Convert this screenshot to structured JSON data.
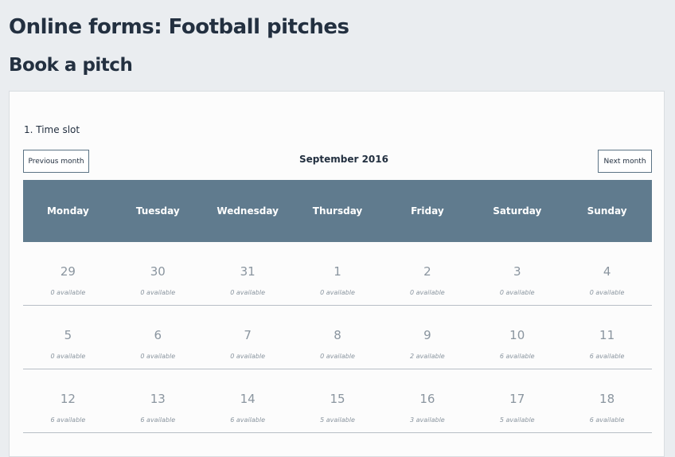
{
  "header": {
    "title": "Online forms: Football pitches",
    "subtitle": "Book a pitch"
  },
  "form": {
    "step_label": "1. Time slot",
    "prev_label": "Previous month",
    "next_label": "Next month",
    "month_label": "September 2016"
  },
  "calendar": {
    "header_color": "#607b8e",
    "days_of_week": [
      "Monday",
      "Tuesday",
      "Wednesday",
      "Thursday",
      "Friday",
      "Saturday",
      "Sunday"
    ],
    "weeks": [
      [
        {
          "day": "29",
          "availability": "0 available"
        },
        {
          "day": "30",
          "availability": "0 available"
        },
        {
          "day": "31",
          "availability": "0 available"
        },
        {
          "day": "1",
          "availability": "0 available"
        },
        {
          "day": "2",
          "availability": "0 available"
        },
        {
          "day": "3",
          "availability": "0 available"
        },
        {
          "day": "4",
          "availability": "0 available"
        }
      ],
      [
        {
          "day": "5",
          "availability": "0 available"
        },
        {
          "day": "6",
          "availability": "0 available"
        },
        {
          "day": "7",
          "availability": "0 available"
        },
        {
          "day": "8",
          "availability": "0 available"
        },
        {
          "day": "9",
          "availability": "2 available"
        },
        {
          "day": "10",
          "availability": "6 available"
        },
        {
          "day": "11",
          "availability": "6 available"
        }
      ],
      [
        {
          "day": "12",
          "availability": "6 available"
        },
        {
          "day": "13",
          "availability": "6 available"
        },
        {
          "day": "14",
          "availability": "6 available"
        },
        {
          "day": "15",
          "availability": "5 available"
        },
        {
          "day": "16",
          "availability": "3 available"
        },
        {
          "day": "17",
          "availability": "5 available"
        },
        {
          "day": "18",
          "availability": "6 available"
        }
      ]
    ]
  }
}
